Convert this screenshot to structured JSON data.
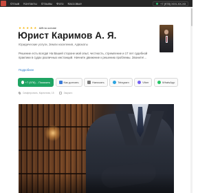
{
  "header": {
    "nav": [
      "Отзыв",
      "Контакты",
      "Отзывы",
      "Фото",
      "Кассовые"
    ],
    "phone": "+7 (978) ХХХ-ХХ-ХХ"
  },
  "profile": {
    "stars": [
      "★",
      "★",
      "★",
      "★",
      "★"
    ],
    "rating": "4.9",
    "reviews": "на основе",
    "name": "Юрист Каримов А. Я.",
    "subtitle": "Юридические услуги, Земли населения, Адвокаты",
    "description": "Решение есть всегда! На Вашей стороне мой опыт, честность, стремление и 17 лет судебной практики в судах различных инстанций. Начните движение к решению проблемы. Звоните!...",
    "more": "Подробнее"
  },
  "actions": {
    "call": "+7 (978)...  Показать",
    "route": "Как доехать",
    "message": "Написать",
    "telegram": "Telegram",
    "viber": "Viber",
    "whatsapp": "WhatsApp"
  },
  "meta": {
    "address": "Симферополь, Кирпичная, 15",
    "schedule": "Закрыто"
  },
  "colors": {
    "accent_green": "#1fa463",
    "link_blue": "#2a78c9",
    "star": "#f5b50a",
    "topbar": "#262626"
  },
  "icons": {
    "phone": "phone-icon",
    "route": "route-icon",
    "message": "message-icon",
    "telegram": "telegram-icon",
    "viber": "viber-icon",
    "whatsapp": "whatsapp-icon"
  }
}
